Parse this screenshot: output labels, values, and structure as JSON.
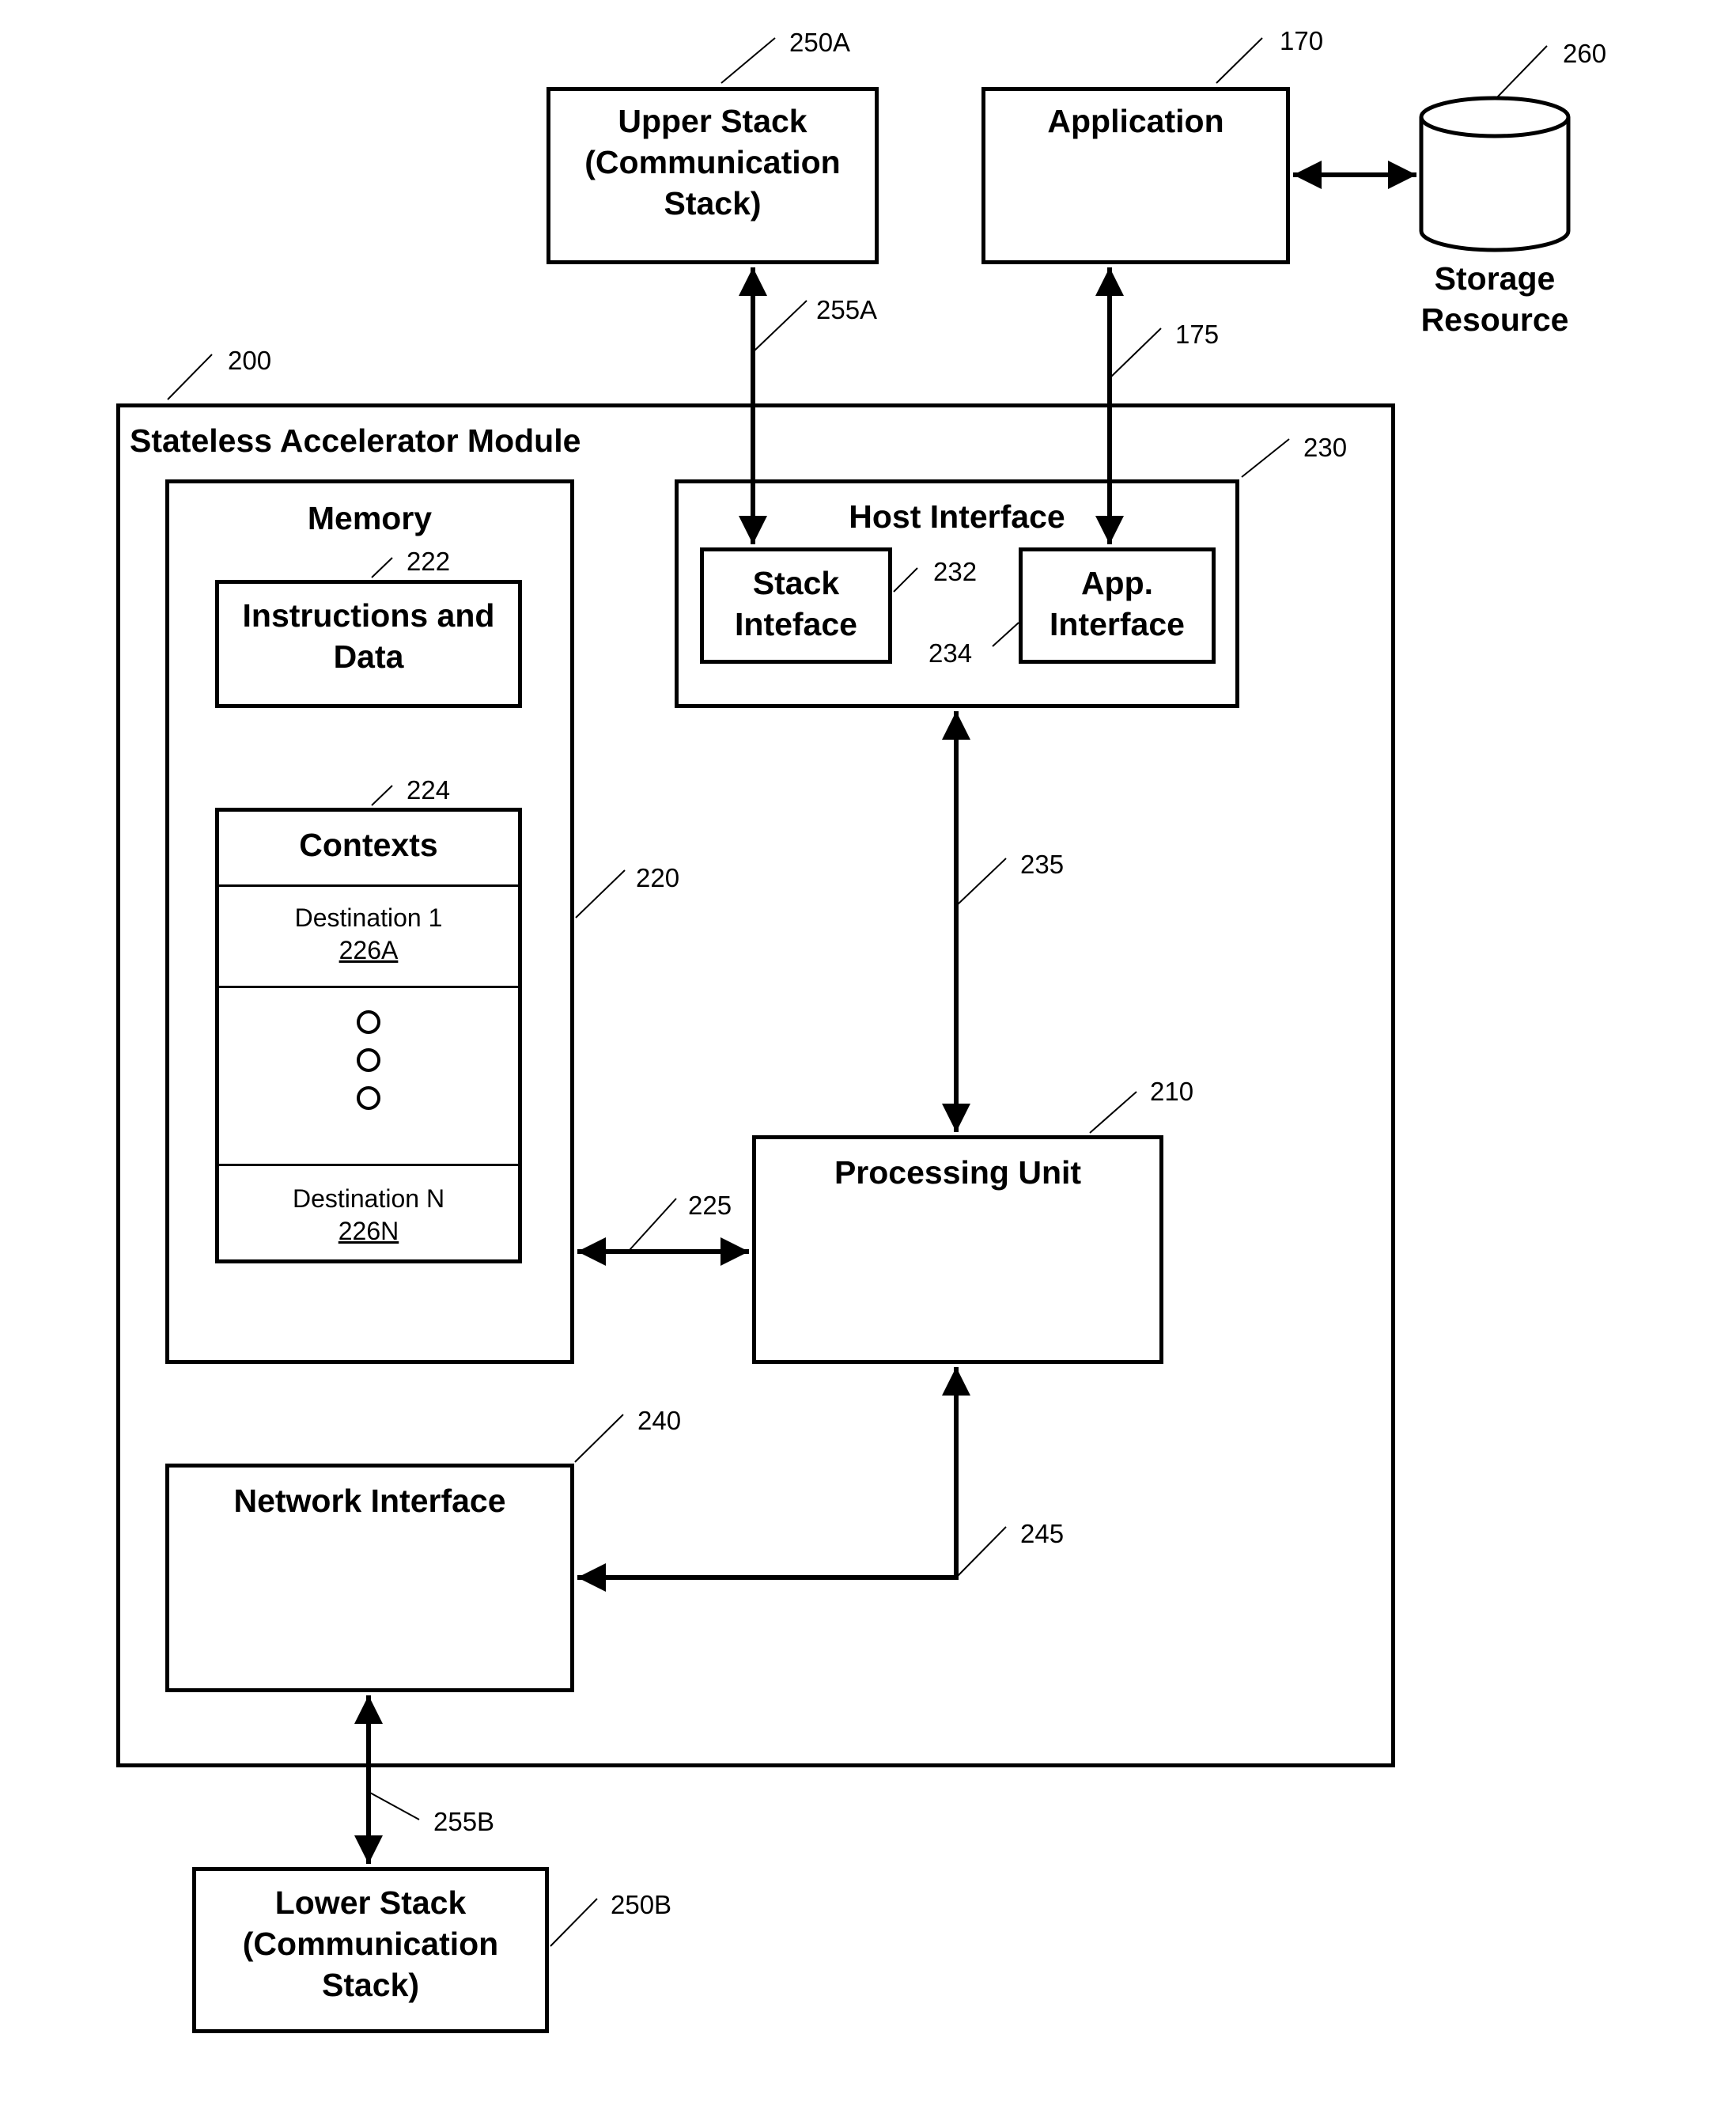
{
  "figure": {
    "module": {
      "title": "Stateless Accelerator Module",
      "ref": "200"
    },
    "upper_stack": {
      "lines": [
        "Upper Stack",
        "(Communication",
        "Stack)"
      ],
      "ref": "250A"
    },
    "application": {
      "title": "Application",
      "ref": "170"
    },
    "storage": {
      "lines": [
        "Storage",
        "Resource"
      ],
      "ref": "260"
    },
    "memory": {
      "title": "Memory",
      "ref": "220"
    },
    "instructions": {
      "lines": [
        "Instructions and",
        "Data"
      ],
      "ref": "222"
    },
    "contexts": {
      "title": "Contexts",
      "ref": "224",
      "rows": [
        {
          "label": "Destination 1",
          "ref": "226A"
        },
        {
          "label": "Destination N",
          "ref": "226N"
        }
      ],
      "ellipsis_count": 3
    },
    "host_interface": {
      "title": "Host Interface",
      "ref": "230"
    },
    "stack_interface": {
      "lines": [
        "Stack",
        "Inteface"
      ],
      "ref": "232"
    },
    "app_interface": {
      "lines": [
        "App.",
        "Interface"
      ],
      "ref": "234"
    },
    "processing_unit": {
      "title": "Processing Unit",
      "ref": "210"
    },
    "network_interface": {
      "title": "Network Interface",
      "ref": "240"
    },
    "lower_stack": {
      "lines": [
        "Lower Stack",
        "(Communication",
        "Stack)"
      ],
      "ref": "250B"
    },
    "connections": [
      {
        "ref": "255A",
        "from": "upper_stack",
        "to": "stack_interface",
        "direction": "bidirectional"
      },
      {
        "ref": "175",
        "from": "application",
        "to": "app_interface",
        "direction": "bidirectional"
      },
      {
        "ref": "235",
        "from": "host_interface",
        "to": "processing_unit",
        "direction": "bidirectional"
      },
      {
        "ref": "225",
        "from": "memory",
        "to": "processing_unit",
        "direction": "bidirectional"
      },
      {
        "ref": "245",
        "from": "processing_unit",
        "to": "network_interface",
        "direction": "bidirectional"
      },
      {
        "ref": "255B",
        "from": "network_interface",
        "to": "lower_stack",
        "direction": "bidirectional"
      },
      {
        "ref": "",
        "from": "application",
        "to": "storage",
        "direction": "bidirectional"
      }
    ]
  }
}
